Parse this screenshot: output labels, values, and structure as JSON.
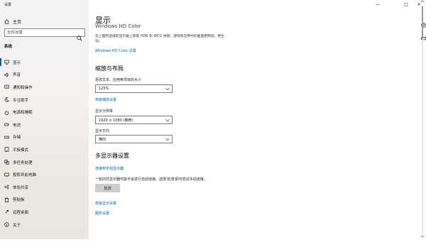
{
  "window": {
    "title": "设置",
    "controls": {
      "minimize": "—",
      "maximize": "□",
      "close": "✕"
    }
  },
  "sidebar": {
    "home_label": "主页",
    "search_placeholder": "查找设置",
    "section_label": "系统",
    "items": [
      {
        "label": "显示",
        "icon": "monitor-icon",
        "active": true
      },
      {
        "label": "声音",
        "icon": "speaker-icon"
      },
      {
        "label": "通知和操作",
        "icon": "notification-icon"
      },
      {
        "label": "专注助手",
        "icon": "moon-icon"
      },
      {
        "label": "电源和睡眠",
        "icon": "power-icon"
      },
      {
        "label": "电池",
        "icon": "battery-icon"
      },
      {
        "label": "存储",
        "icon": "storage-icon"
      },
      {
        "label": "平板模式",
        "icon": "tablet-icon"
      },
      {
        "label": "多任务处理",
        "icon": "multitask-icon"
      },
      {
        "label": "投影到此电脑",
        "icon": "project-icon"
      },
      {
        "label": "体验共享",
        "icon": "share-icon"
      },
      {
        "label": "剪贴板",
        "icon": "clipboard-icon"
      },
      {
        "label": "远程桌面",
        "icon": "remote-icon"
      },
      {
        "label": "关于",
        "icon": "info-icon"
      }
    ]
  },
  "main": {
    "page_title": "显示",
    "clipped_heading": "Windows HD Color",
    "hd_color_desc": "在上面所选择的显示器上获取 HDR 和 WCG 视频、游戏和应用中的画面更明亮、更生动。",
    "hd_color_link": "Windows HD Color 设置",
    "scale_layout": {
      "heading": "缩放与布局",
      "text_size_label": "更改文本、应用等项目的大小",
      "text_size_value": "125%",
      "advanced_scaling_link": "高级缩放设置",
      "resolution_label": "显示分辨率",
      "resolution_value": "1920 × 1080 (推荐)",
      "orientation_label": "显示方向",
      "orientation_value": "横向"
    },
    "multi_display": {
      "heading": "多显示器设置",
      "wireless_link": "连接到无线显示器",
      "detect_desc": "一些旧式显示器可能不会进行自动连接。选择'检测'即可尝试手动连接。",
      "detect_button": "检测",
      "advanced_display_link": "高级显示设置",
      "graphics_link": "图形设置"
    }
  }
}
